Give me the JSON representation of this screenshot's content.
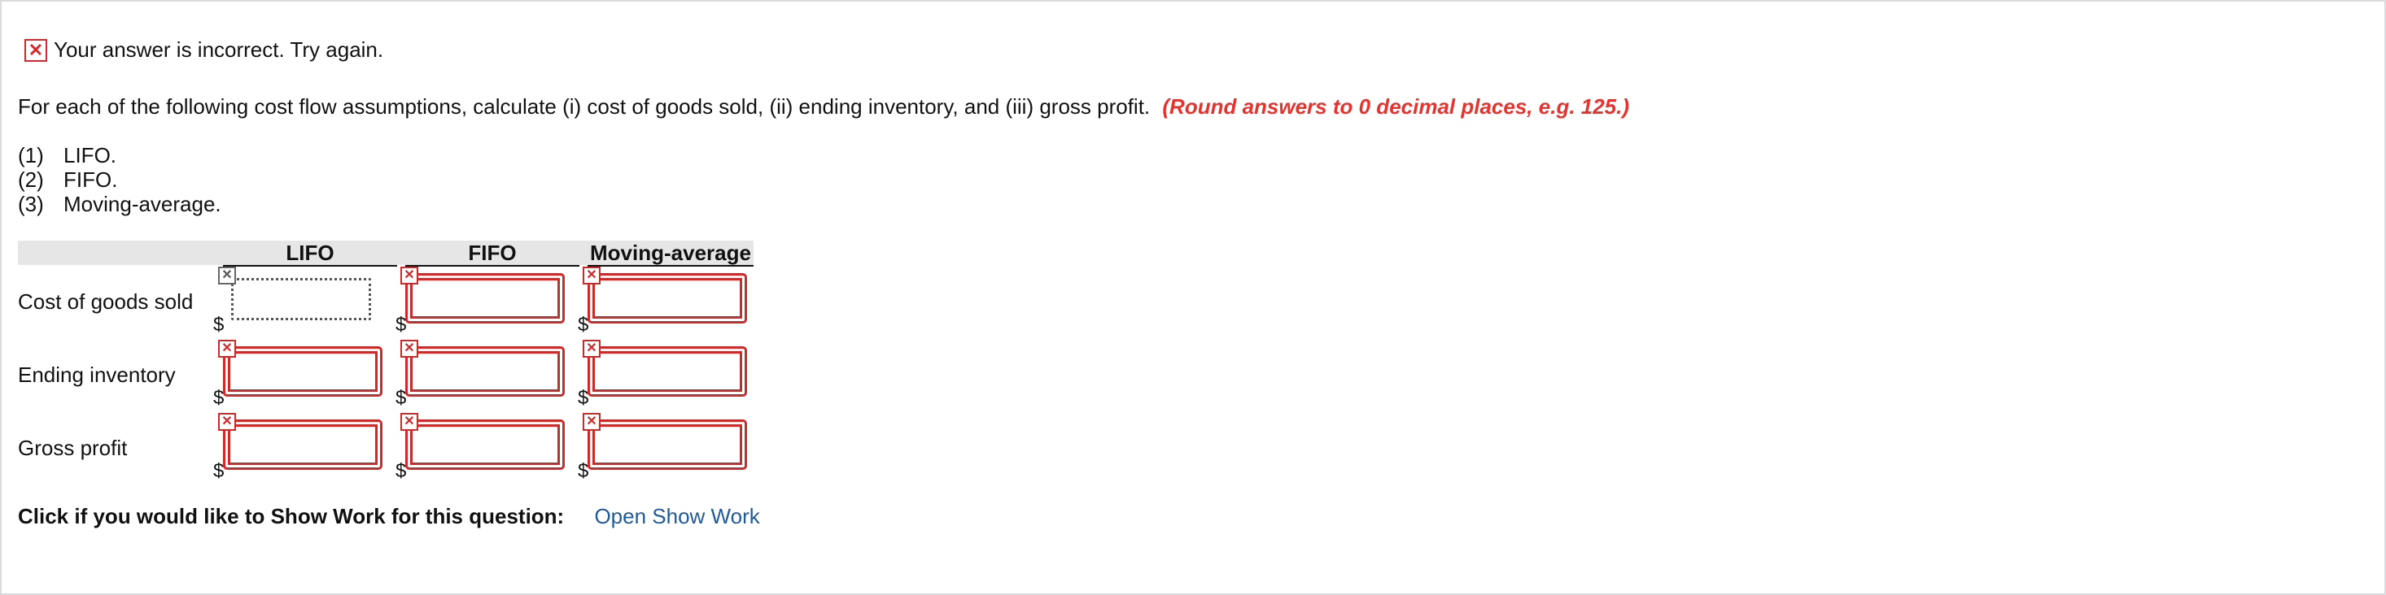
{
  "feedback": {
    "icon": "x-icon",
    "icon_glyph": "✕",
    "message": "Your answer is incorrect.  Try again."
  },
  "instructions": {
    "text": "For each of the following cost flow assumptions, calculate (i) cost of goods sold, (ii) ending inventory, and (iii) gross profit.",
    "round_note": "(Round answers to 0 decimal places, e.g. 125.)"
  },
  "methods": [
    {
      "num": "(1)",
      "label": "LIFO."
    },
    {
      "num": "(2)",
      "label": "FIFO."
    },
    {
      "num": "(3)",
      "label": "Moving-average."
    }
  ],
  "table": {
    "columns": [
      "LIFO",
      "FIFO",
      "Moving-average"
    ],
    "rows": [
      {
        "label": "Cost of goods sold",
        "values": [
          "",
          "",
          ""
        ]
      },
      {
        "label": "Ending inventory",
        "values": [
          "",
          "",
          ""
        ]
      },
      {
        "label": "Gross profit",
        "values": [
          "",
          "",
          ""
        ]
      }
    ],
    "currency_symbol": "$",
    "incorrect_glyph": "✕",
    "error_color": "#cf2a2a"
  },
  "show_work": {
    "question": "Click if you would like to Show Work for this question:",
    "link": "Open Show Work"
  }
}
